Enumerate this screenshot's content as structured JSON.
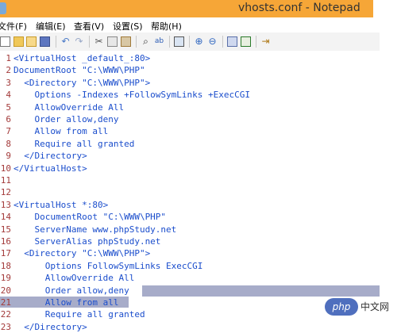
{
  "window": {
    "title": "vhosts.conf - Notepad"
  },
  "menu": [
    "文件(F)",
    "编辑(E)",
    "查看(V)",
    "设置(S)",
    "帮助(H)"
  ],
  "toolbar": {
    "icons": [
      "new-file-icon",
      "open-file-icon",
      "open-folder-icon",
      "save-icon",
      "undo-icon",
      "redo-icon",
      "cut-icon",
      "copy-icon",
      "paste-icon",
      "find-icon",
      "replace-icon",
      "goto-icon",
      "zoom-in-icon",
      "zoom-out-icon",
      "word-wrap-icon",
      "scheme-icon",
      "exit-icon"
    ]
  },
  "colors": {
    "titlebar": "#f6a637",
    "line_number": "#a33a3a",
    "keyword": "#1a4dcc",
    "string": "#c0392b",
    "selection": "#a7acc9"
  },
  "editor": {
    "lines": [
      {
        "n": "1",
        "t": "<VirtualHost _default_:80>"
      },
      {
        "n": "2",
        "t": "DocumentRoot \"C:\\WWW\\PHP\""
      },
      {
        "n": "3",
        "t": "  <Directory \"C:\\WWW\\PHP\">"
      },
      {
        "n": "4",
        "t": "    Options -Indexes +FollowSymLinks +ExecCGI"
      },
      {
        "n": "5",
        "t": "    AllowOverride All"
      },
      {
        "n": "6",
        "t": "    Order allow,deny"
      },
      {
        "n": "7",
        "t": "    Allow from all"
      },
      {
        "n": "8",
        "t": "    Require all granted"
      },
      {
        "n": "9",
        "t": "  </Directory>"
      },
      {
        "n": "10",
        "t": "</VirtualHost>"
      },
      {
        "n": "11",
        "t": ""
      },
      {
        "n": "12",
        "t": ""
      },
      {
        "n": "13",
        "t": "<VirtualHost *:80>"
      },
      {
        "n": "14",
        "t": "    DocumentRoot \"C:\\WWW\\PHP\""
      },
      {
        "n": "15",
        "t": "    ServerName www.phpStudy.net"
      },
      {
        "n": "16",
        "t": "    ServerAlias phpStudy.net"
      },
      {
        "n": "17",
        "t": "  <Directory \"C:\\WWW\\PHP\">"
      },
      {
        "n": "18",
        "t": "      Options FollowSymLinks ExecCGI"
      },
      {
        "n": "19",
        "t": "      AllowOverride All"
      },
      {
        "n": "20",
        "t": "      Order allow,deny"
      },
      {
        "n": "21",
        "t": "      Allow from all"
      },
      {
        "n": "22",
        "t": "      Require all granted"
      },
      {
        "n": "23",
        "t": "  </Directory>"
      }
    ]
  },
  "watermark": {
    "logo": "php",
    "text": "中文网"
  }
}
